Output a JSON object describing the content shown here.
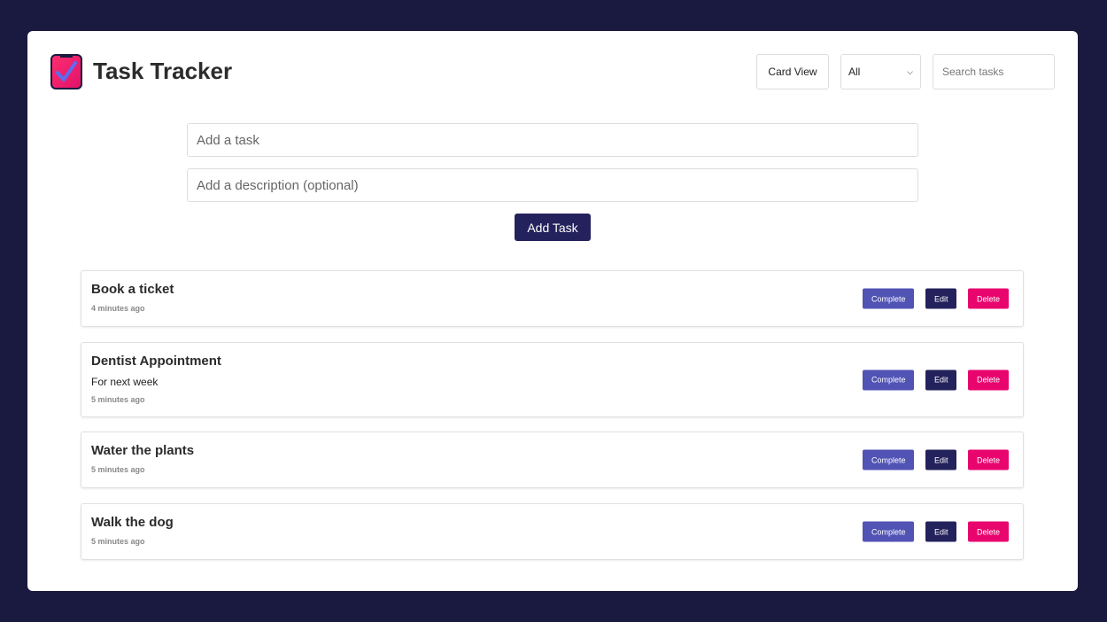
{
  "header": {
    "title": "Task Tracker",
    "view_toggle": "Card View",
    "filter": "All",
    "search_placeholder": "Search tasks"
  },
  "form": {
    "task_placeholder": "Add a task",
    "description_placeholder": "Add a description (optional)",
    "add_label": "Add Task"
  },
  "actions": {
    "complete": "Complete",
    "edit": "Edit",
    "delete": "Delete"
  },
  "colors": {
    "background": "#1a1a40",
    "complete": "#5153b5",
    "edit": "#24225c",
    "delete": "#e8066e"
  },
  "tasks": [
    {
      "title": "Book a ticket",
      "description": "",
      "time": "4 minutes ago"
    },
    {
      "title": "Dentist Appointment",
      "description": "For next week",
      "time": "5 minutes ago"
    },
    {
      "title": "Water the plants",
      "description": "",
      "time": "5 minutes ago"
    },
    {
      "title": "Walk the dog",
      "description": "",
      "time": "5 minutes ago"
    }
  ]
}
